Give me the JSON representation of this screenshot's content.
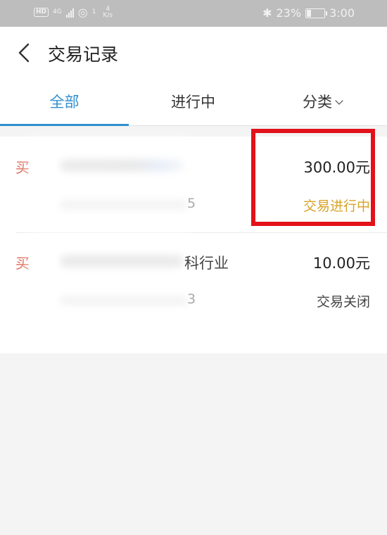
{
  "status_bar": {
    "hd": "HD",
    "net": "4G",
    "wifi_level": "1",
    "speed_value": "4",
    "speed_unit": "K/s",
    "battery": "23%",
    "battery_level": 0.23,
    "time": "3:00"
  },
  "header": {
    "title": "交易记录"
  },
  "tabs": [
    {
      "label": "全部",
      "active": true
    },
    {
      "label": "进行中",
      "active": false
    },
    {
      "label": "分类",
      "active": false
    }
  ],
  "transactions": [
    {
      "type": "买",
      "title_tail": "",
      "sub_tail": "5",
      "amount": "300.00元",
      "status": "交易进行中",
      "status_color": "#d9a327"
    },
    {
      "type": "买",
      "title_tail": "科行业",
      "sub_tail": "3",
      "amount": "10.00元",
      "status": "交易关闭",
      "status_color": "#444444"
    }
  ],
  "colors": {
    "accent": "#2f8fd1",
    "highlight": "#e2111a",
    "in_progress": "#d9a327"
  }
}
